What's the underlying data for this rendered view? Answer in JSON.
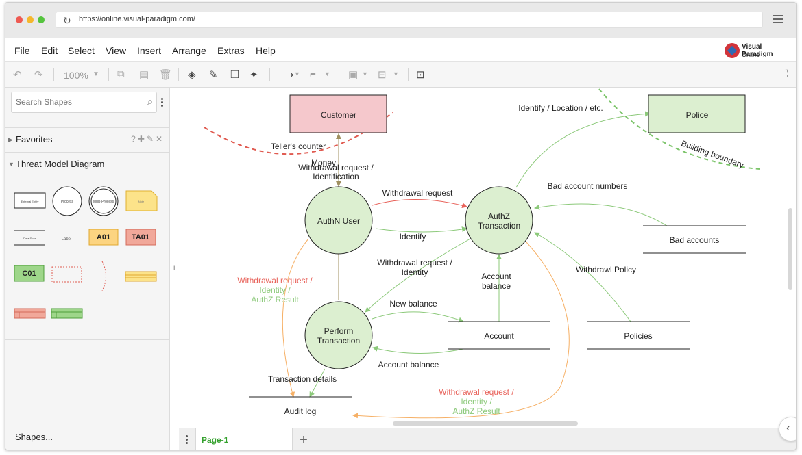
{
  "browser": {
    "url": "https://online.visual-paradigm.com/"
  },
  "menubar": {
    "items": [
      "File",
      "Edit",
      "Select",
      "View",
      "Insert",
      "Arrange",
      "Extras",
      "Help"
    ]
  },
  "logo": {
    "line1": "Visual Paradigm",
    "line2": "Online"
  },
  "toolbar": {
    "zoom": "100%"
  },
  "sidebar": {
    "search_placeholder": "Search Shapes",
    "favorites_label": "Favorites",
    "threat_model_label": "Threat Model Diagram",
    "shapes_footer": "Shapes...",
    "palette": {
      "external": "External Entity",
      "process": "Process",
      "multi_process": "Multi-Process",
      "note": "Note",
      "data_store": "Data Store",
      "label": "Label",
      "a01": "A01",
      "ta01": "TA01",
      "c01": "C01"
    }
  },
  "diagram": {
    "entities": {
      "customer": "Customer",
      "police": "Police"
    },
    "processes": {
      "authn": "AuthN User",
      "authz": [
        "AuthZ",
        "Transaction"
      ],
      "perform": [
        "Perform",
        "Transaction"
      ]
    },
    "stores": {
      "bad_accounts": "Bad accounts",
      "account": "Account",
      "policies": "Policies",
      "audit_log": "Audit log"
    },
    "boundaries": {
      "teller": "Teller's counter",
      "building": "Building boundary"
    },
    "flows": {
      "identify_location": "Identify / Location / etc.",
      "money": "Money",
      "withdrawal_identification": [
        "Withdrawal request /",
        "Identification"
      ],
      "withdrawal_request": "Withdrawal request",
      "bad_account_numbers": "Bad account numbers",
      "identify": "Identify",
      "withdrawal_identity": [
        "Withdrawal request /",
        "Identity"
      ],
      "account_balance_up": [
        "Account",
        "balance"
      ],
      "withdrawl_policy": "Withdrawl Policy",
      "new_balance": "New balance",
      "account_balance": "Account balance",
      "transaction_details": "Transaction details",
      "left_withdrawal_line1": "Withdrawal request /",
      "left_withdrawal_line2": "Identity /",
      "left_withdrawal_line3": "AuthZ Result",
      "bottom_withdrawal_line1": "Withdrawal request /",
      "bottom_withdrawal_line2": "Identity /",
      "bottom_withdrawal_line3": "AuthZ Result"
    }
  },
  "pages": {
    "active": "Page-1"
  },
  "colors": {
    "red_flow": "#e8625a",
    "green_flow": "#8cc97a",
    "orange_flow": "#f6b066",
    "green_tab": "#33a02c"
  }
}
